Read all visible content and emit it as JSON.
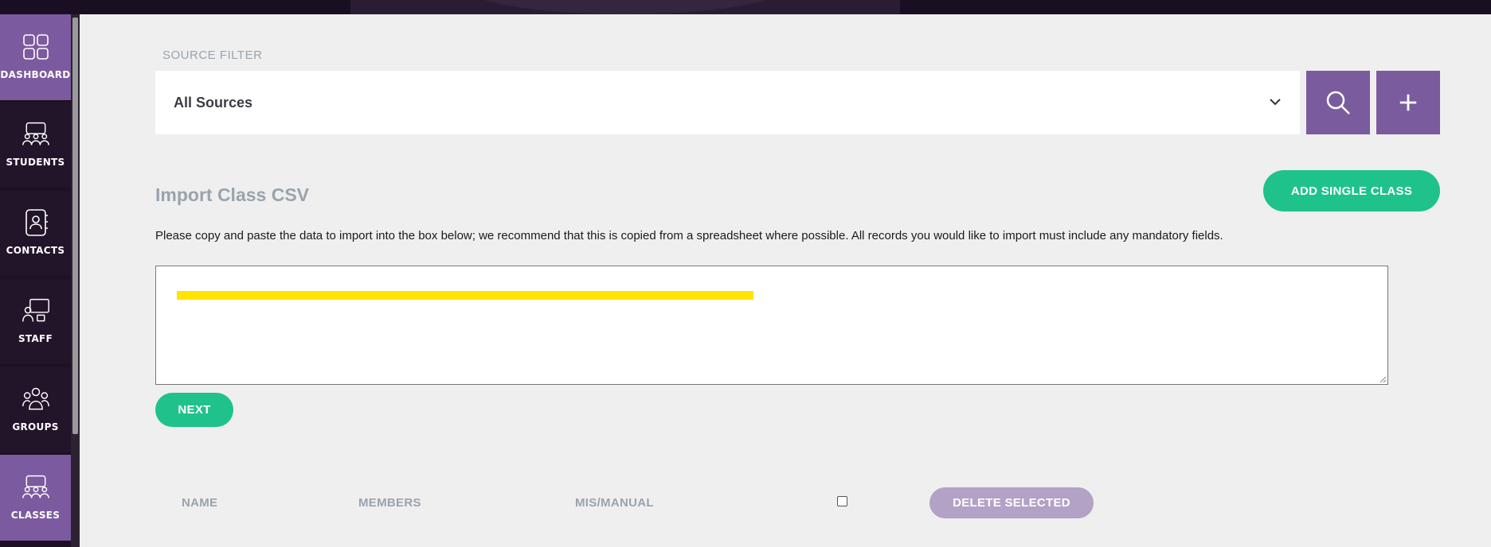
{
  "sidebar": {
    "items": [
      {
        "label": "DASHBOARD",
        "icon": "grid-icon",
        "active": true
      },
      {
        "label": "STUDENTS",
        "icon": "students-icon",
        "active": false
      },
      {
        "label": "CONTACTS",
        "icon": "contacts-icon",
        "active": false
      },
      {
        "label": "STAFF",
        "icon": "staff-icon",
        "active": false
      },
      {
        "label": "GROUPS",
        "icon": "groups-icon",
        "active": false
      },
      {
        "label": "CLASSES",
        "icon": "classes-icon",
        "active": true
      }
    ]
  },
  "filter": {
    "label": "SOURCE FILTER",
    "selected": "All Sources"
  },
  "import": {
    "title": "Import Class CSV",
    "add_single_label": "ADD SINGLE CLASS",
    "instructions": "Please copy and paste the data to import into the box below; we recommend that this is copied from a spreadsheet where possible. All records you would like to import must include any mandatory fields.",
    "next_label": "NEXT"
  },
  "table": {
    "columns": [
      "NAME",
      "MEMBERS",
      "MIS/MANUAL"
    ],
    "delete_label": "DELETE SELECTED"
  },
  "colors": {
    "accent_purple": "#7a5c9e",
    "accent_green": "#1fc28b",
    "sidebar_bg": "#1c1022",
    "highlight_yellow": "#ffe400"
  }
}
